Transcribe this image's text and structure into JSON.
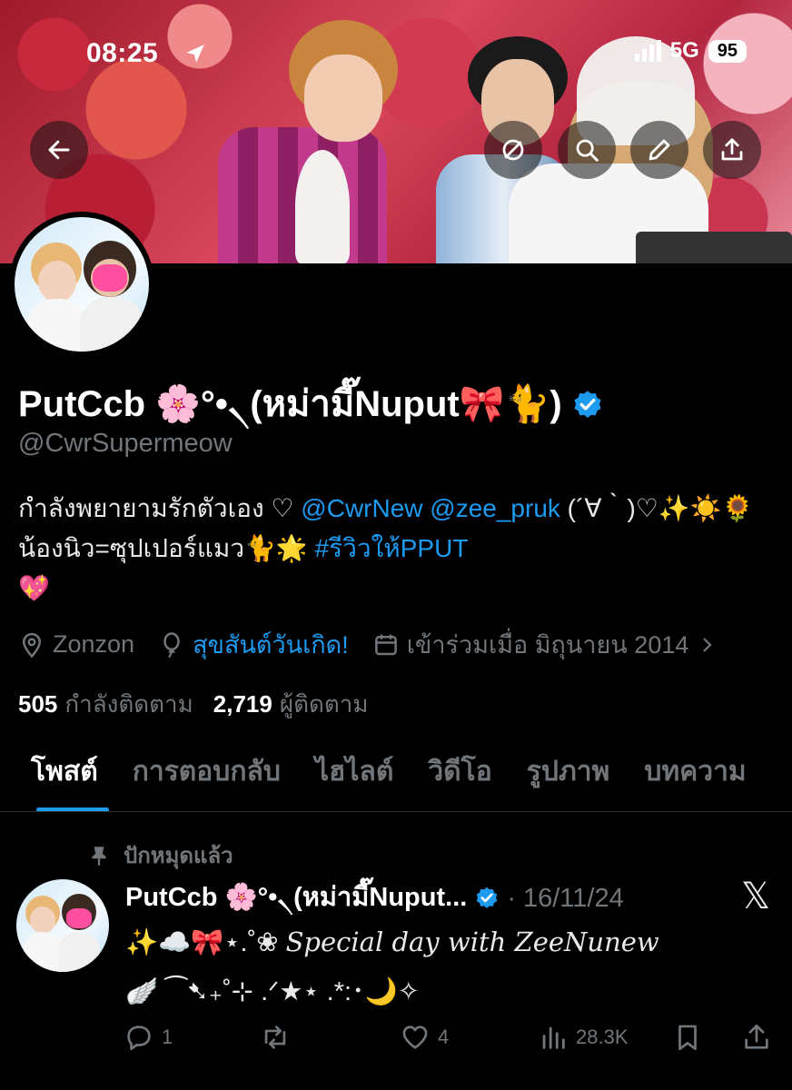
{
  "status_bar": {
    "time": "08:25",
    "network": "5G",
    "battery": "95"
  },
  "profile": {
    "display_name": "PutCcb 🌸°•৲(หม่ามี๊Nuput🎀🐈)",
    "handle": "@CwrSupermeow",
    "bio_part1": "กำลังพยายามรักตัวเอง ♡ ",
    "bio_mention1": "@CwrNew",
    "bio_mention2": "@zee_pruk",
    "bio_part2": " (´∀｀)♡✨☀️🌻น้องนิว=ซุปเปอร์แมว🐈🌟 ",
    "bio_hashtag": "#รีวิวให้PPUT",
    "bio_part3": "💖",
    "location": "Zonzon",
    "birthday": "สุขสันต์วันเกิด!",
    "joined": "เข้าร่วมเมื่อ มิถุนายน 2014",
    "following_count": "505",
    "following_label": "กำลังติดตาม",
    "followers_count": "2,719",
    "followers_label": "ผู้ติดตาม"
  },
  "tabs": [
    "โพสต์",
    "การตอบกลับ",
    "ไฮไลต์",
    "วิดีโอ",
    "รูปภาพ",
    "บทความ"
  ],
  "post": {
    "pinned_label": "ปักหมุดแล้ว",
    "author": "PutCcb 🌸°•৲(หม่ามี๊Nuput...",
    "separator": "·",
    "date": "16/11/24",
    "line1_prefix": "✨☁️🎀⋆.˚❀ ",
    "line1_script": "𝑆𝑝𝑒𝑐𝑖𝑎𝑙 𝑑𝑎𝑦 𝑤𝑖𝑡ℎ 𝑍𝑒𝑒𝑁𝑢𝑛𝑒𝑤",
    "line2": "🪽 ⁀➷₊˚⊹ .ᐟ★⋆ .*:･🌙✧",
    "replies": "1",
    "likes": "4",
    "views": "28.3K"
  },
  "colors": {
    "accent": "#1d9bf0",
    "muted": "#71767b",
    "text": "#e7e9ea",
    "background": "#000000"
  },
  "icons": [
    "back-icon",
    "hide-icon",
    "search-icon",
    "edit-icon",
    "share-icon",
    "location-icon",
    "balloon-icon",
    "calendar-icon",
    "chevron-right-icon",
    "pin-icon",
    "x-logo-icon",
    "reply-icon",
    "repost-icon",
    "like-icon",
    "views-icon",
    "bookmark-icon"
  ]
}
